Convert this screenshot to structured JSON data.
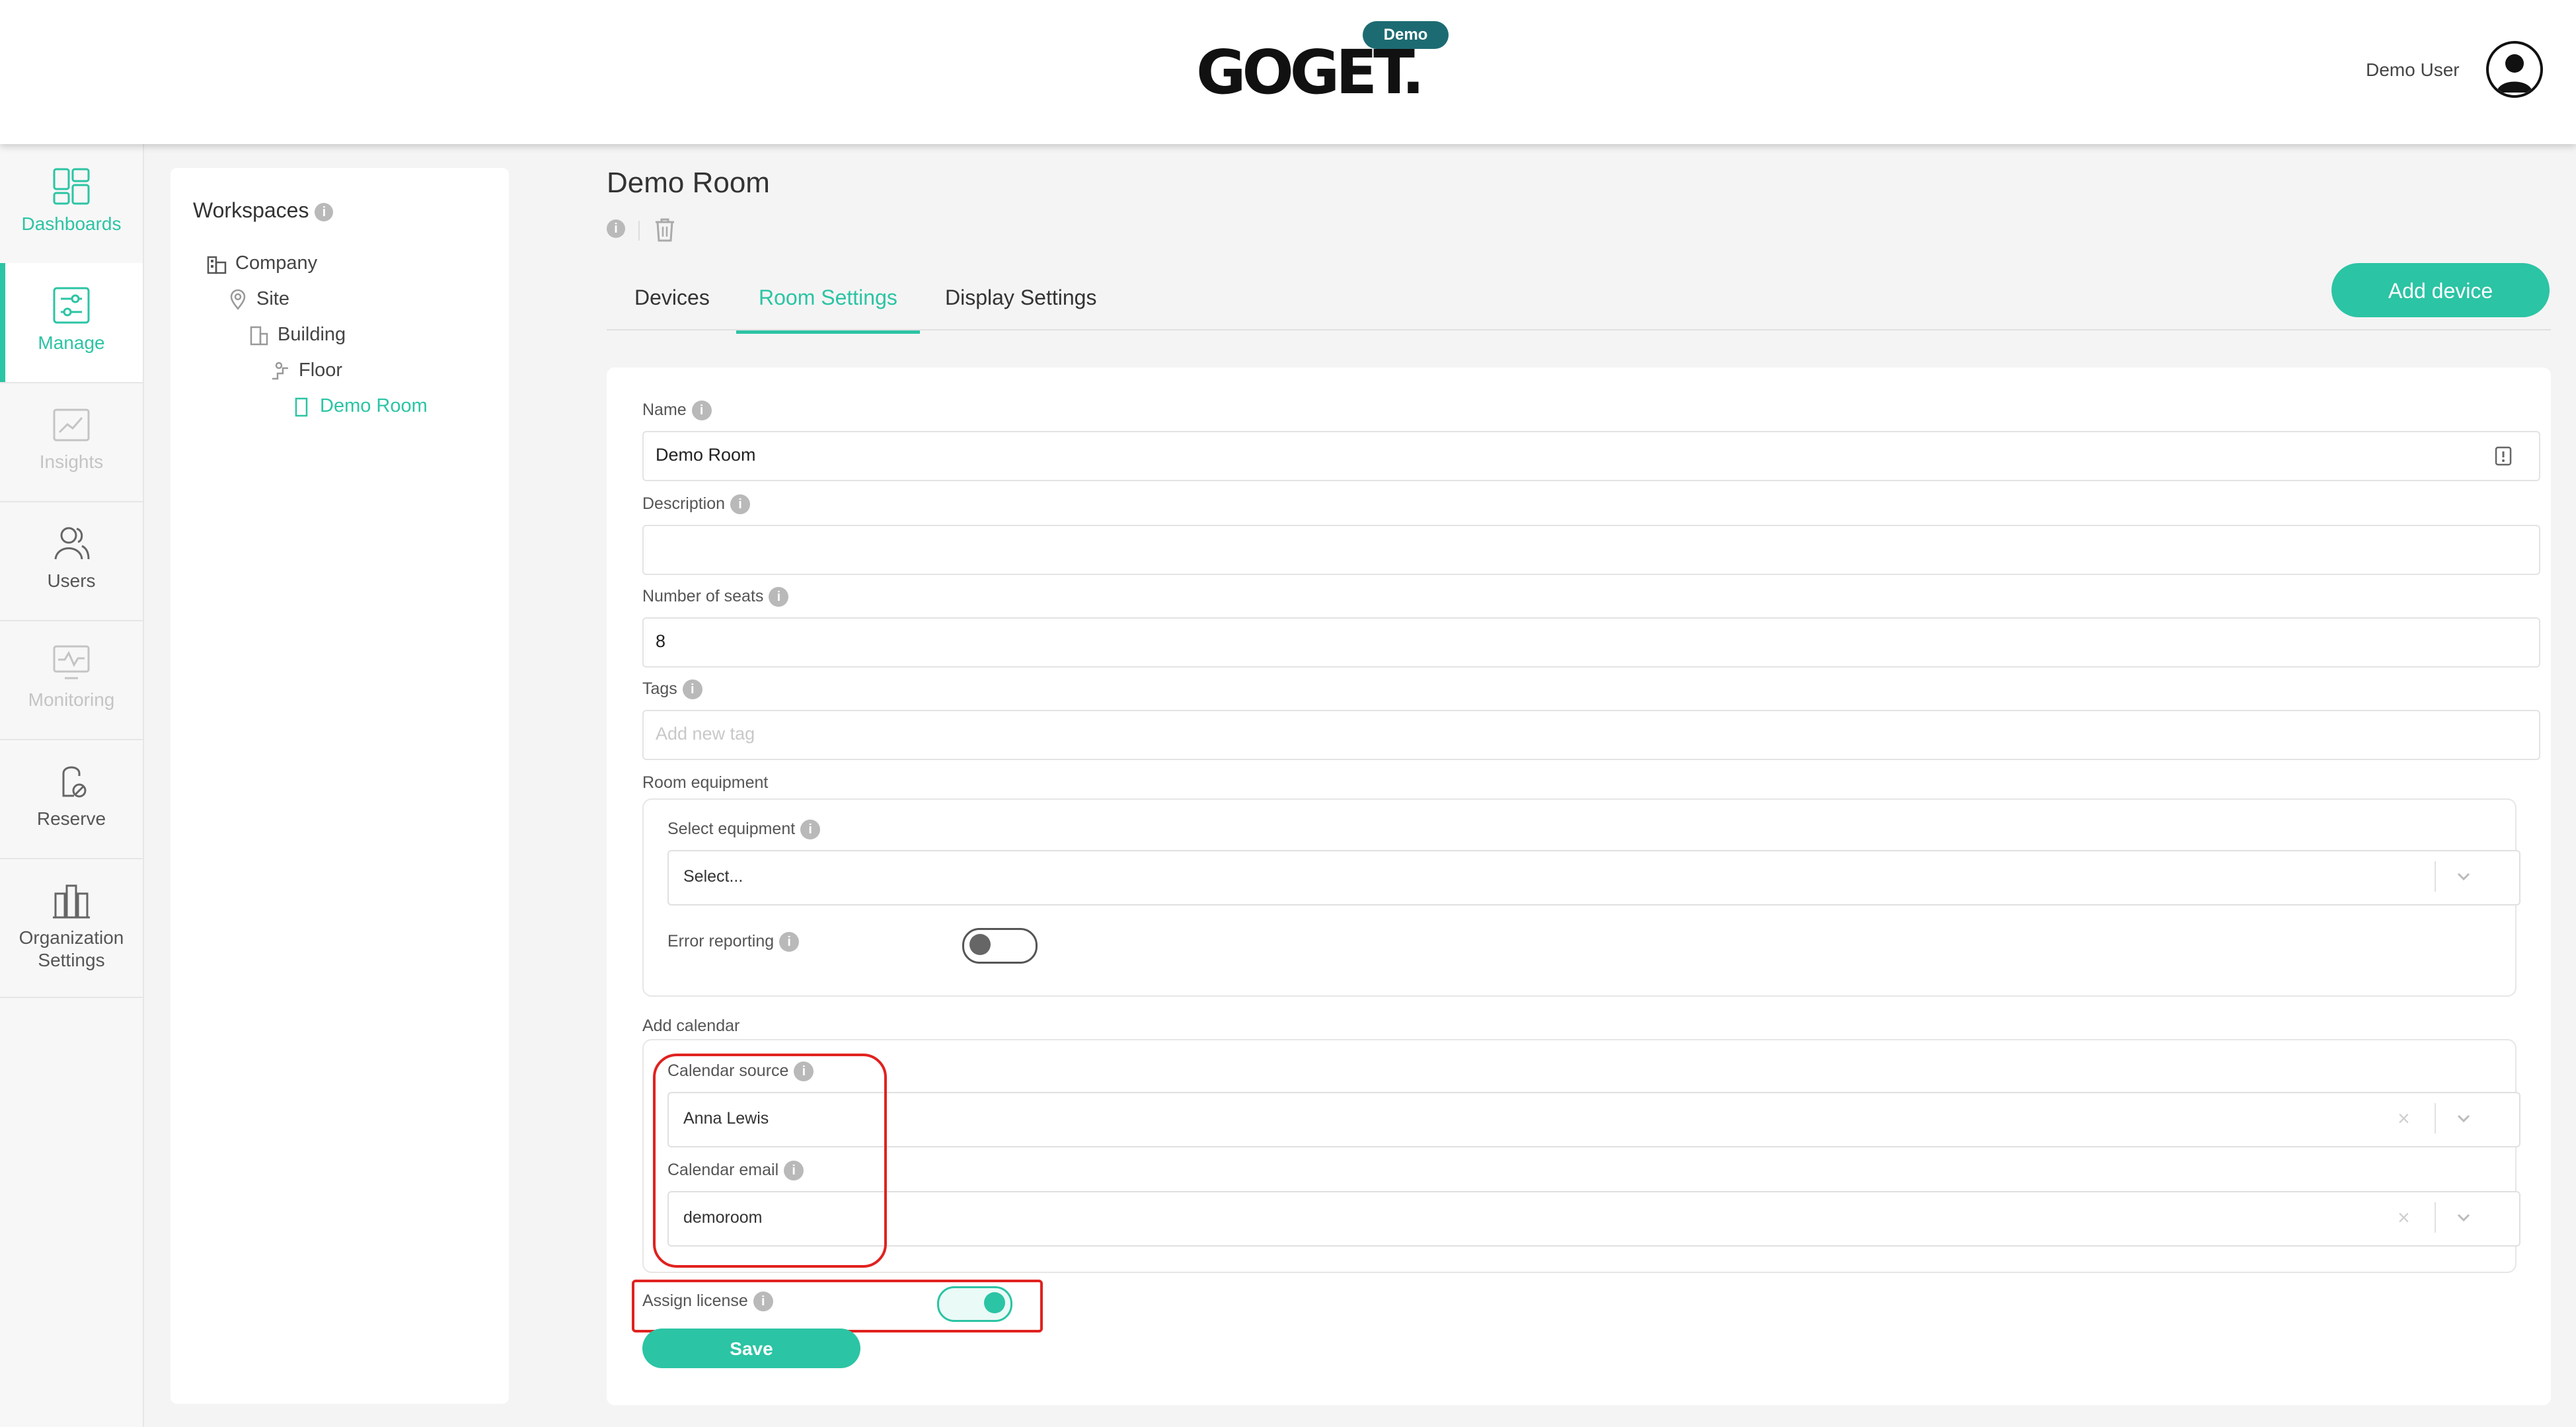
{
  "header": {
    "logo_text": "GOGET.",
    "badge": "Demo",
    "user_name": "Demo User"
  },
  "sidebar": {
    "items": [
      {
        "label": "Dashboards",
        "icon": "dashboard-icon",
        "active": false
      },
      {
        "label": "Manage",
        "icon": "manage-icon",
        "active": true
      },
      {
        "label": "Insights",
        "icon": "insights-icon",
        "active": false
      },
      {
        "label": "Users",
        "icon": "users-icon",
        "active": false
      },
      {
        "label": "Monitoring",
        "icon": "monitoring-icon",
        "active": false
      },
      {
        "label": "Reserve",
        "icon": "reserve-icon",
        "active": false
      },
      {
        "label": "Organization Settings",
        "icon": "organization-icon",
        "active": false
      }
    ]
  },
  "workspaces": {
    "title": "Workspaces",
    "tree": [
      {
        "label": "Company",
        "icon": "company-icon",
        "level": 0
      },
      {
        "label": "Site",
        "icon": "location-pin-icon",
        "level": 1
      },
      {
        "label": "Building",
        "icon": "building-icon",
        "level": 2
      },
      {
        "label": "Floor",
        "icon": "floor-icon",
        "level": 3
      },
      {
        "label": "Demo Room",
        "icon": "room-icon",
        "level": 4,
        "selected": true
      }
    ]
  },
  "main": {
    "title": "Demo Room",
    "tabs": [
      {
        "label": "Devices",
        "active": false
      },
      {
        "label": "Room Settings",
        "active": true
      },
      {
        "label": "Display Settings",
        "active": false
      }
    ],
    "add_device_label": "Add device"
  },
  "form": {
    "name_label": "Name",
    "name_value": "Demo Room",
    "description_label": "Description",
    "description_value": "",
    "seats_label": "Number of seats",
    "seats_value": "8",
    "tags_label": "Tags",
    "tags_placeholder": "Add new tag",
    "equipment_section": "Room equipment",
    "select_equipment_label": "Select equipment",
    "select_equipment_placeholder": "Select...",
    "error_reporting_label": "Error reporting",
    "error_reporting_on": false,
    "calendar_section": "Add calendar",
    "calendar_source_label": "Calendar source",
    "calendar_source_value": "Anna Lewis",
    "calendar_email_label": "Calendar email",
    "calendar_email_value": "demoroom",
    "assign_license_label": "Assign license",
    "assign_license_on": true,
    "save_label": "Save"
  },
  "colors": {
    "accent": "#2bc4a4",
    "badge": "#1d6b72",
    "highlight": "#e0221f"
  }
}
